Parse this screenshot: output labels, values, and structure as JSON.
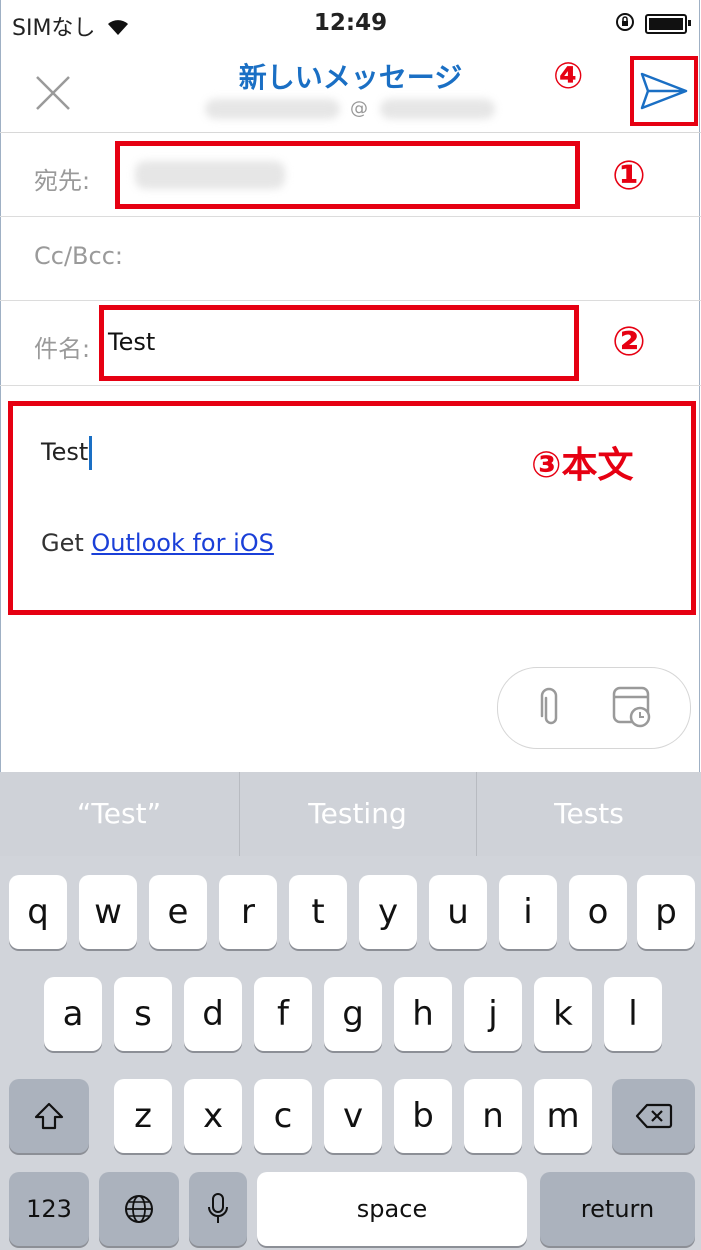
{
  "status": {
    "carrier": "SIMなし",
    "time": "12:49"
  },
  "header": {
    "title": "新しいメッセージ",
    "from_at": "@"
  },
  "fields": {
    "to_label": "宛先:",
    "cc_label": "Cc/Bcc:",
    "subject_label": "件名:",
    "subject_value": "Test"
  },
  "body": {
    "text": "Test",
    "sig_prefix": "Get ",
    "sig_link": "Outlook for iOS"
  },
  "annotations": {
    "a1": "①",
    "a2": "②",
    "a3": "③本文",
    "a4": "④"
  },
  "keyboard": {
    "suggestions": [
      "“Test”",
      "Testing",
      "Tests"
    ],
    "row1": [
      "q",
      "w",
      "e",
      "r",
      "t",
      "y",
      "u",
      "i",
      "o",
      "p"
    ],
    "row2": [
      "a",
      "s",
      "d",
      "f",
      "g",
      "h",
      "j",
      "k",
      "l"
    ],
    "row3": [
      "z",
      "x",
      "c",
      "v",
      "b",
      "n",
      "m"
    ],
    "numbers_label": "123",
    "space_label": "space",
    "return_label": "return"
  },
  "colors": {
    "accent": "#1a6fc4",
    "annotation": "#e60012",
    "link": "#1a3fd8"
  }
}
